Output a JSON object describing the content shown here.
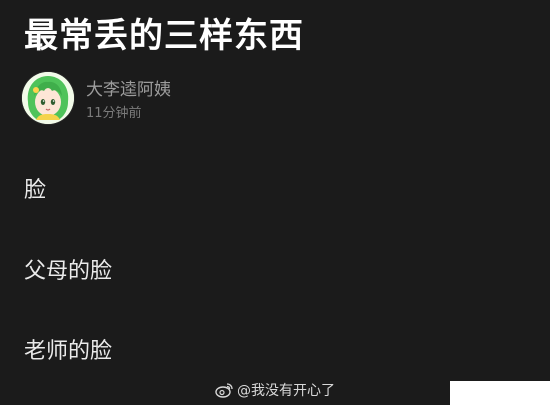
{
  "post": {
    "title": "最常丢的三样东西",
    "author": {
      "name": "大李逵阿姨",
      "time": "11分钟前",
      "avatar_icon": "anime-avatar-green-hair"
    },
    "items": [
      "脸",
      "父母的脸",
      "老师的脸"
    ]
  },
  "watermark": {
    "icon": "weibo-icon",
    "text": "@我没有开心了"
  },
  "colors": {
    "background": "#1b1b1b",
    "text_primary": "#ffffff",
    "text_secondary": "#9c9c9c",
    "corner_patch": "#ffffff"
  }
}
